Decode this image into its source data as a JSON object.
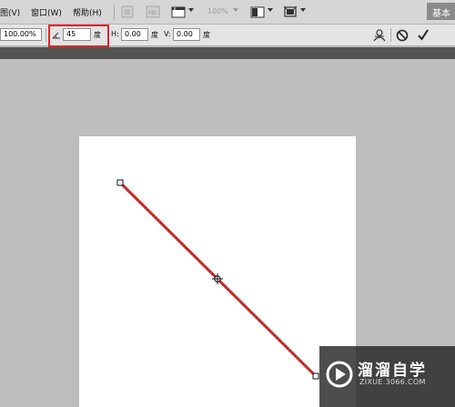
{
  "menu": {
    "items": [
      "图(V)",
      "窗口(W)",
      "帮助(H)"
    ],
    "zoom": "100%",
    "workspace": "基本"
  },
  "options": {
    "width_value": "100.00%",
    "angle_value": "45",
    "angle_unit": "度",
    "h_skew_label": "H:",
    "h_skew_value": "0.00",
    "h_skew_unit": "度",
    "v_skew_label": "V:",
    "v_skew_value": "0.00",
    "v_skew_unit": "度"
  },
  "watermark": {
    "title": "溜溜自学",
    "subtitle": "ZIXUE.3066.COM"
  },
  "colors": {
    "line": "#c81d1d",
    "highlight": "#e0262a"
  }
}
